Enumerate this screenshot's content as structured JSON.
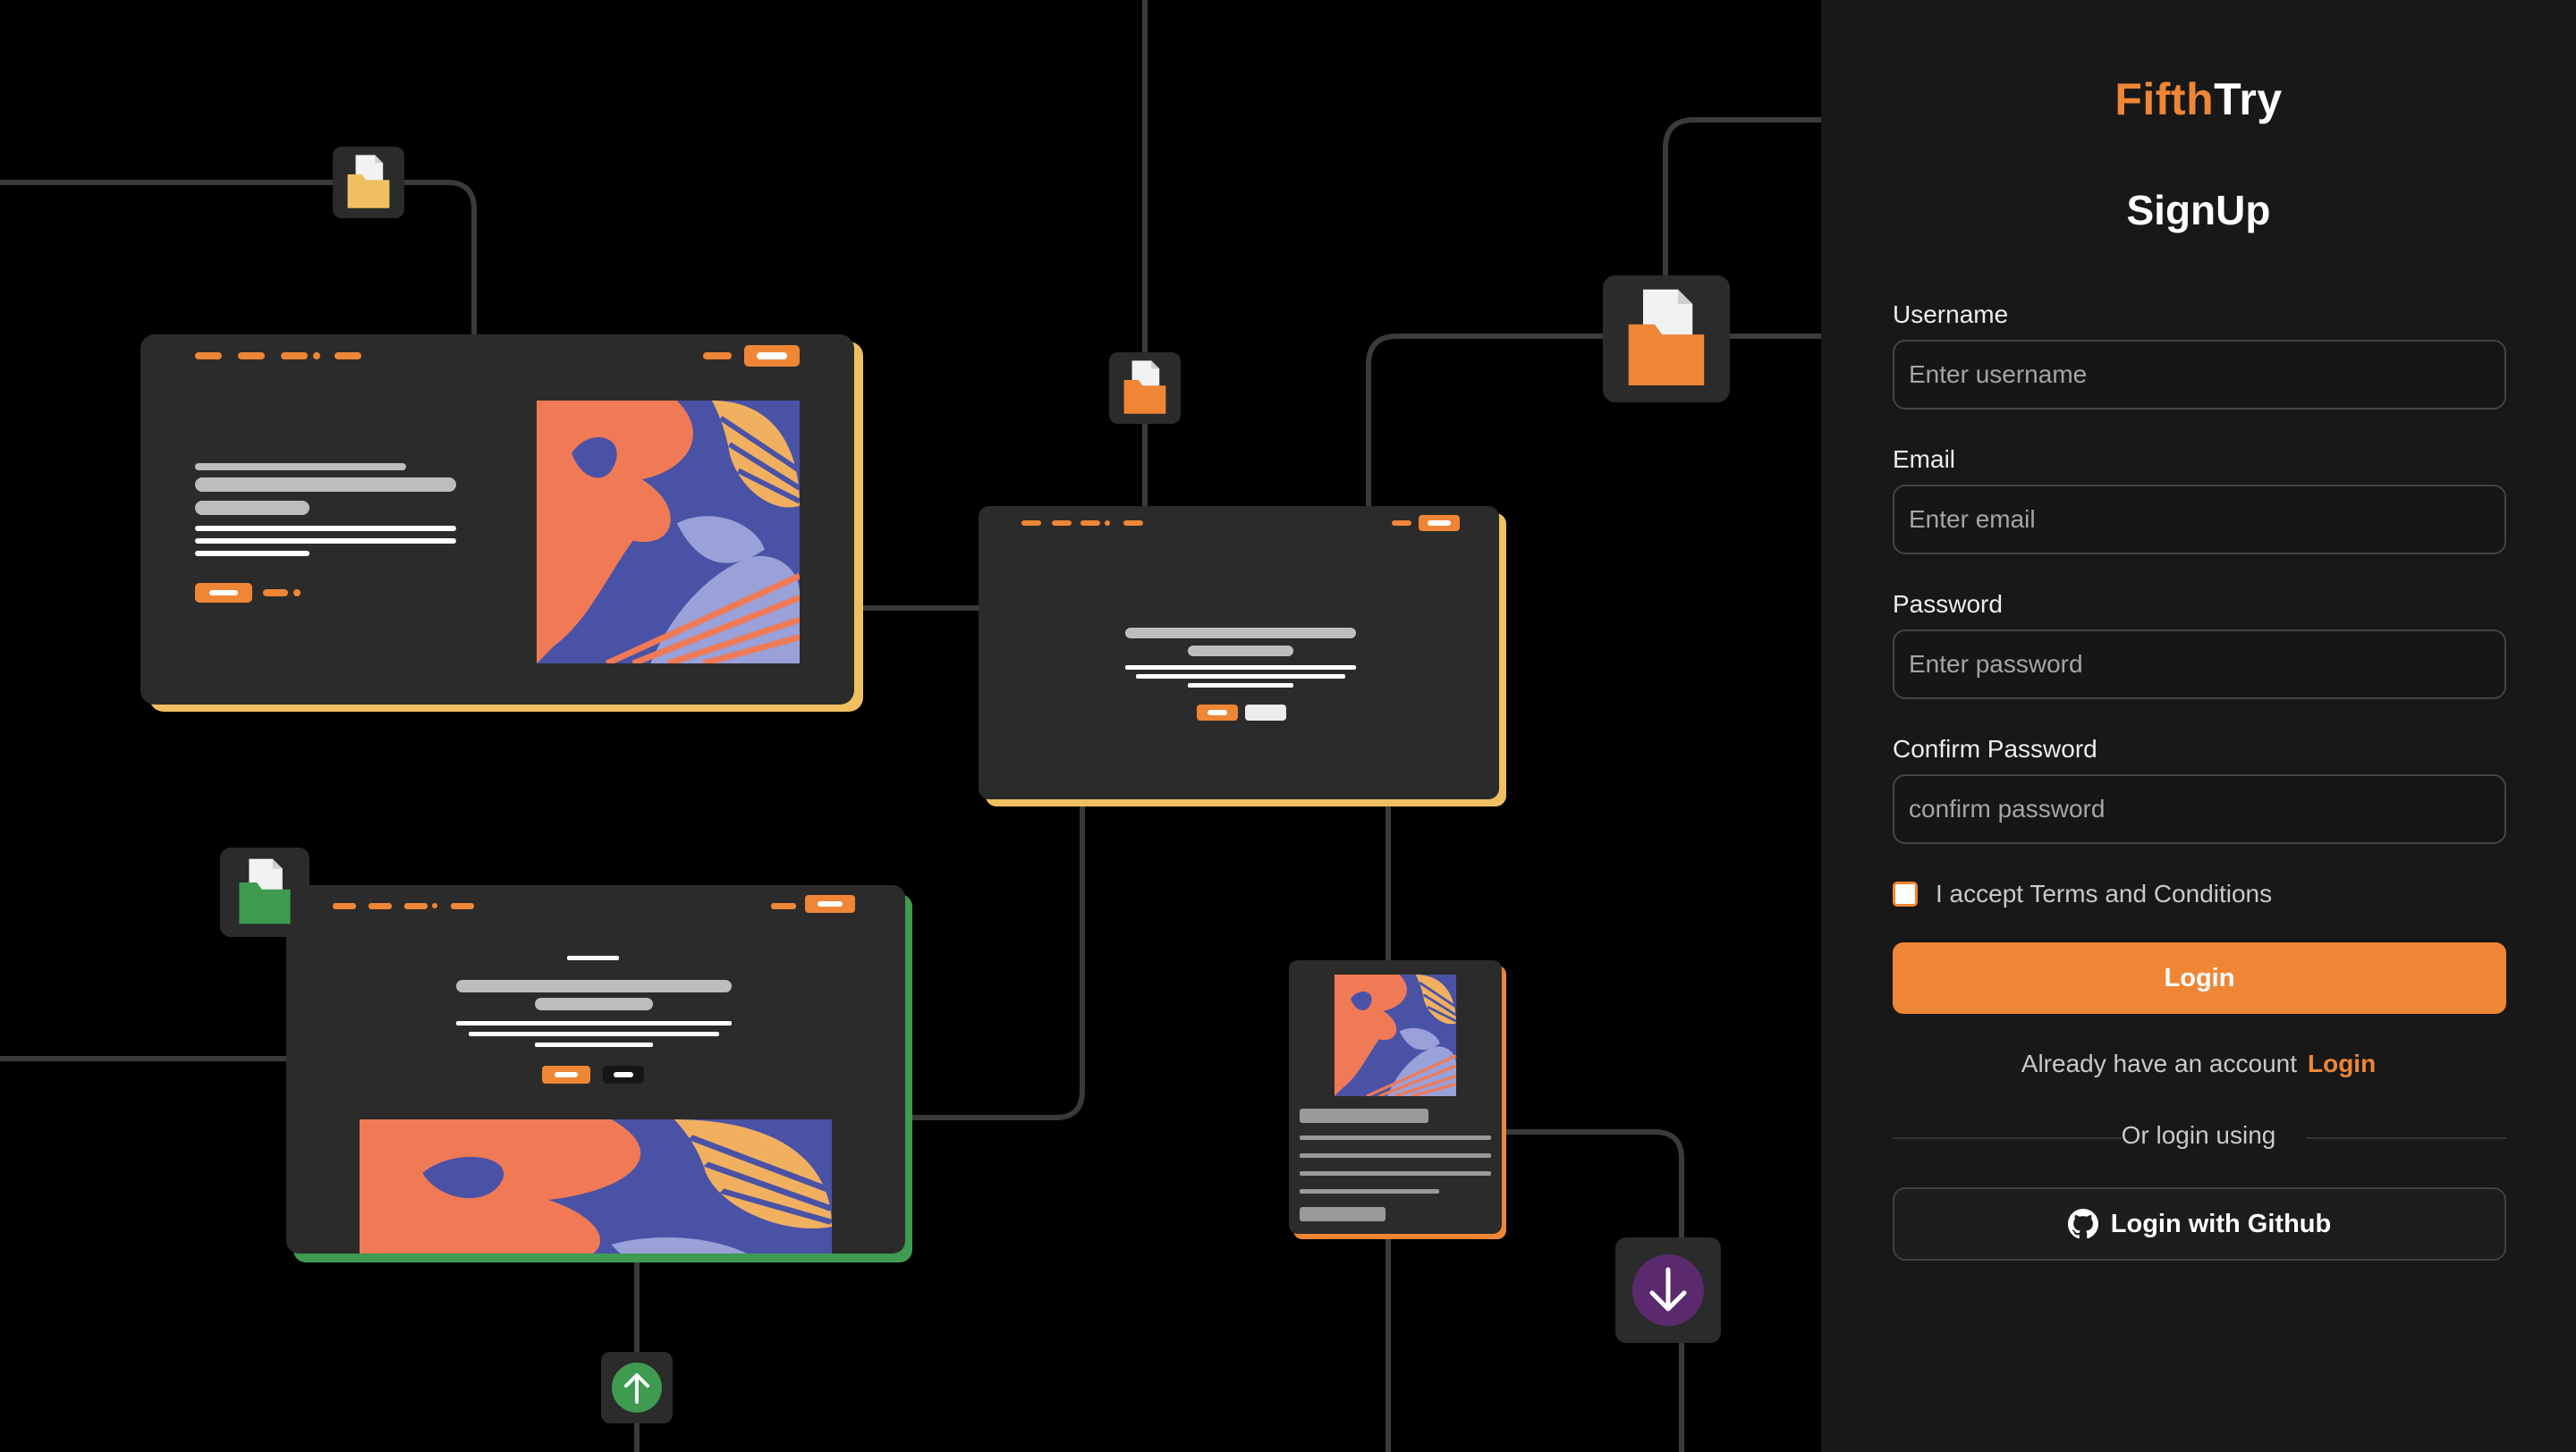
{
  "brand": {
    "part1": "Fifth",
    "part2": "Try",
    "accent_color": "#ef8636"
  },
  "form": {
    "title": "SignUp",
    "fields": [
      {
        "label": "Username",
        "placeholder": "Enter username",
        "value": ""
      },
      {
        "label": "Email",
        "placeholder": "Enter email",
        "value": ""
      },
      {
        "label": "Password",
        "placeholder": "Enter password",
        "value": ""
      },
      {
        "label": "Confirm Password",
        "placeholder": "confirm password",
        "value": ""
      }
    ],
    "terms_label": "I accept Terms and Conditions",
    "terms_checked": false,
    "submit_label": "Login",
    "already_text": "Already have an account",
    "already_link": "Login",
    "divider_text": "Or login using",
    "github_label": "Login with Github",
    "github_icon": "github-icon"
  },
  "illustration": {
    "icons": [
      "file-folder-icon",
      "arrow-up-icon",
      "arrow-down-icon"
    ],
    "colors": {
      "yellow": "#f0c060",
      "green": "#3e9b4f",
      "orange": "#ef8636",
      "purple": "#5b2a6e",
      "card": "#2b2b2b"
    }
  }
}
